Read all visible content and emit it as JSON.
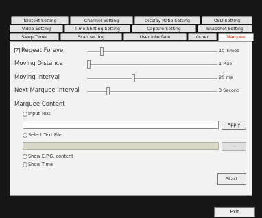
{
  "tabs": {
    "row1": [
      "Teletext Setting",
      "Channel Setting",
      "Display Ratio Setting",
      "OSD Setting"
    ],
    "row2": [
      "Video Setting",
      "Time Shifting Setting",
      "Capture Setting",
      "Snapshot Setting"
    ],
    "row3": [
      "Sleep Timer",
      "Scan setting",
      "User Interface",
      "Other",
      "Marquee"
    ],
    "active": "Marquee"
  },
  "marquee": {
    "repeat": {
      "label": "Repeat Forever",
      "checked": true,
      "value_text": "10 Times",
      "level": 0.1
    },
    "distance": {
      "label": "Moving Distance",
      "value_text": "1 Pixel",
      "level": 0.0
    },
    "interval": {
      "label": "Moving Interval",
      "value_text": "20 ms",
      "level": 0.35
    },
    "next_interval": {
      "label": "Next Marquee Interval",
      "value_text": "3 Second",
      "level": 0.15
    },
    "content_label": "Marquee Content",
    "options": {
      "input_text": "Input Text",
      "select_file": "Select Text File",
      "show_epg": "Show E.P.G. content",
      "show_time": "Show Time"
    },
    "apply_label": "Apply",
    "browse_label": "...",
    "start_label": "Start"
  },
  "exit_label": "Exit"
}
